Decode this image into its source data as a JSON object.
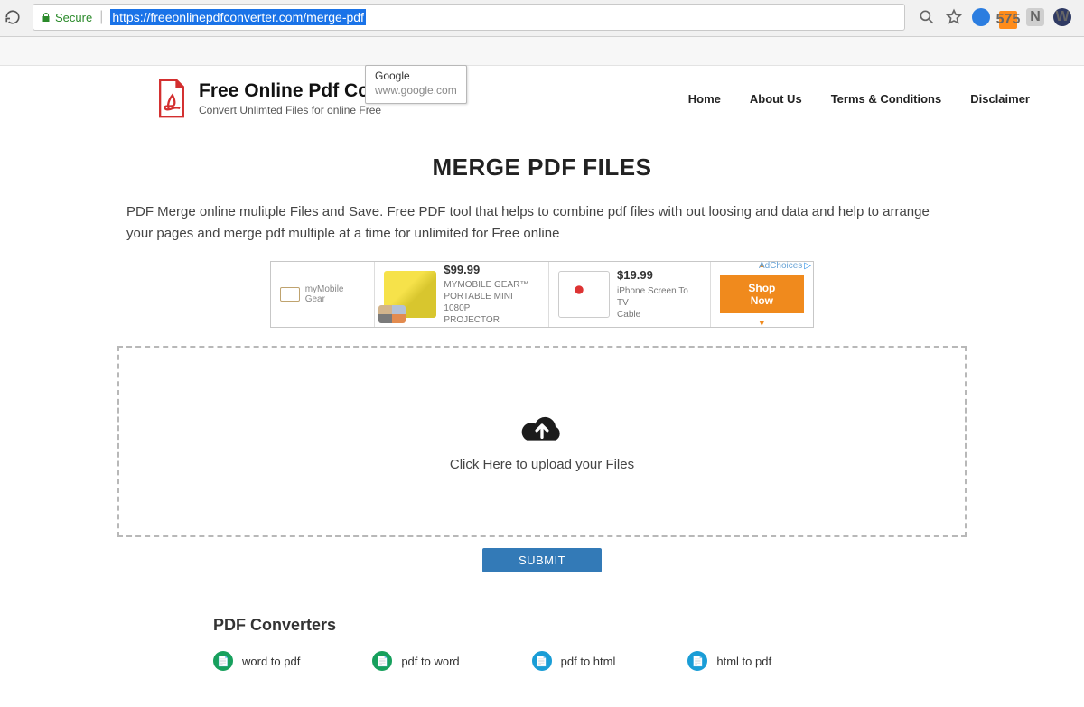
{
  "chrome": {
    "secure_label": "Secure",
    "url": "https://freeonlinepdfconverter.com/merge-pdf",
    "ext_badge": "575",
    "tooltip_title": "Google",
    "tooltip_url": "www.google.com"
  },
  "header": {
    "site_title": "Free Online Pdf Co",
    "tagline": "Convert Unlimted Files for online Free",
    "nav": {
      "home": "Home",
      "about": "About Us",
      "terms": "Terms & Conditions",
      "disclaimer": "Disclaimer"
    }
  },
  "page": {
    "title": "MERGE PDF FILES",
    "description": "PDF Merge online mulitple Files and Save. Free PDF tool that helps to combine pdf files with out loosing and data and help to arrange your pages and merge pdf multiple at a time for unlimited for Free online",
    "upload_label": "Click Here to upload your Files",
    "submit_label": "SUBMIT"
  },
  "ad": {
    "adchoices_label": "AdChoices",
    "brand_label": "myMobile Gear",
    "products": [
      {
        "price": "$99.99",
        "line1": "MYMOBILE GEAR™",
        "line2": "PORTABLE MINI 1080P",
        "line3": "PROJECTOR"
      },
      {
        "price": "$19.99",
        "line1": "iPhone Screen To TV",
        "line2": "Cable",
        "line3": ""
      }
    ],
    "cta": "Shop Now"
  },
  "converters": {
    "section_title": "PDF Converters",
    "items": [
      {
        "label": "word to pdf",
        "color": "green"
      },
      {
        "label": "pdf to word",
        "color": "green"
      },
      {
        "label": "pdf to html",
        "color": "blue"
      },
      {
        "label": "html to pdf",
        "color": "blue"
      }
    ]
  }
}
